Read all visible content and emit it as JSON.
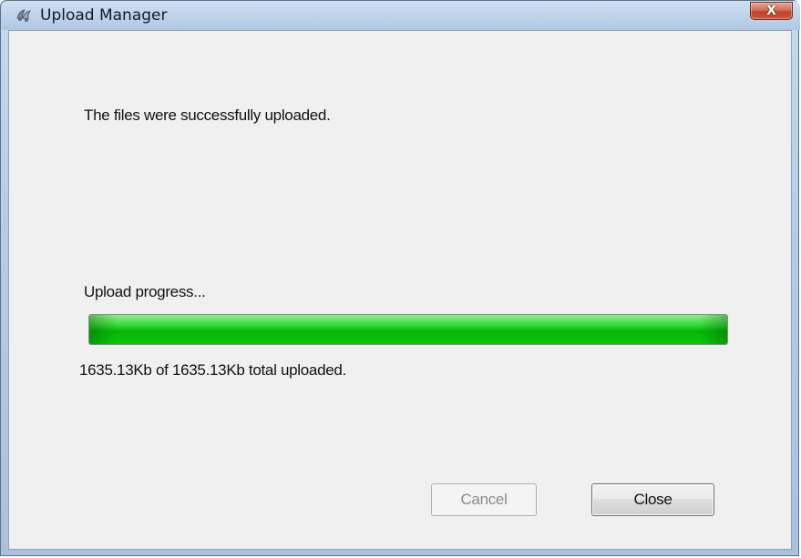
{
  "window": {
    "title": "Upload Manager",
    "icon": "upload-manager-icon",
    "close_glyph": "X",
    "close_icon": "close-icon"
  },
  "dialog": {
    "message": "The files were successfully uploaded.",
    "progress_label": "Upload progress...",
    "progress_text": "1635.13Kb of 1635.13Kb total uploaded.",
    "progress_fraction": 1.0,
    "progress_color": "#0ab40a"
  },
  "buttons": {
    "cancel_label": "Cancel",
    "cancel_enabled": false,
    "close_label": "Close",
    "close_enabled": true
  }
}
